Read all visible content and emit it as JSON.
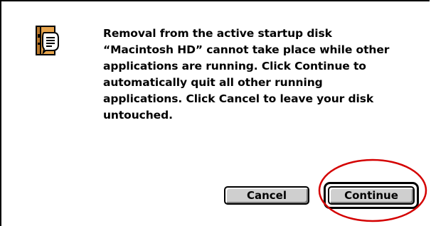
{
  "dialog": {
    "icon": "alert-face-icon",
    "message": "Removal from the active startup disk\n“Macintosh HD” cannot take place while other\napplications are running.  Click Continue to\nautomatically quit all other running\napplications.  Click Cancel to leave your disk\nuntouched."
  },
  "buttons": {
    "cancel_label": "Cancel",
    "continue_label": "Continue"
  },
  "colors": {
    "highlight": "#d40000",
    "button_face": "#cfcfcf",
    "icon_face": "#e6a44c"
  }
}
